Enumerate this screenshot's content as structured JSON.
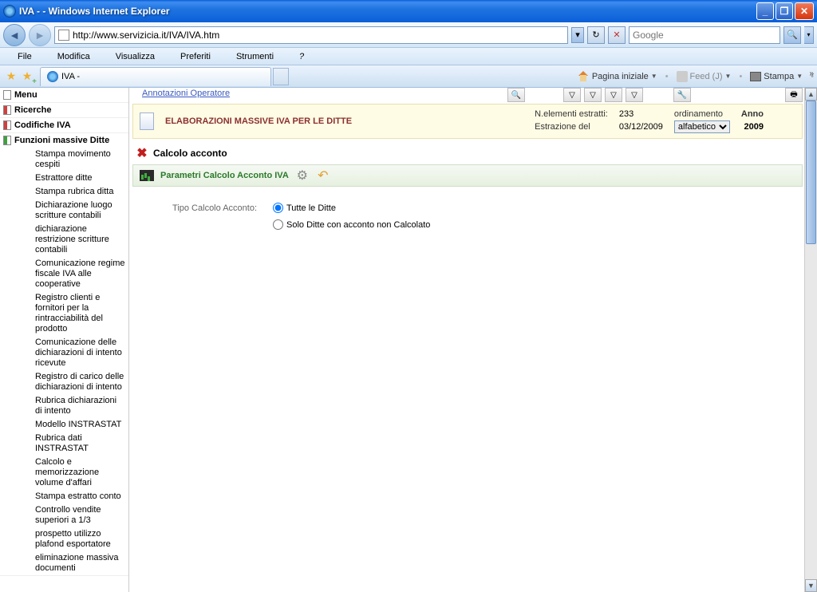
{
  "window": {
    "title": "IVA - - Windows Internet Explorer"
  },
  "address_bar": {
    "url": "http://www.servizicia.it/IVA/IVA.htm"
  },
  "search": {
    "placeholder": "Google"
  },
  "menu": {
    "file": "File",
    "modifica": "Modifica",
    "visualizza": "Visualizza",
    "preferiti": "Preferiti",
    "strumenti": "Strumenti",
    "help": "?"
  },
  "tab": {
    "title": "IVA -"
  },
  "toolbar": {
    "home": "Pagina iniziale",
    "feed": "Feed (J)",
    "stampa": "Stampa"
  },
  "sidebar": {
    "sections": {
      "menu": "Menu",
      "ricerche": "Ricerche",
      "codifiche": "Codifiche IVA",
      "funzioni": "Funzioni massive Ditte"
    },
    "items": [
      "Stampa movimento cespiti",
      "Estrattore ditte",
      "Stampa rubrica ditta",
      "Dichiarazione luogo scritture contabili",
      "dichiarazione restrizione scritture contabili",
      "Comunicazione regime fiscale IVA alle cooperative",
      "Registro clienti e fornitori per la rintracciabilità del prodotto",
      "Comunicazione delle dichiarazioni di intento ricevute",
      "Registro di carico delle dichiarazioni di intento",
      "Rubrica dichiarazioni di intento",
      "Modello INSTRASTAT",
      "Rubrica dati INSTRASTAT",
      "Calcolo e memorizzazione volume d'affari",
      "Stampa estratto conto",
      "Controllo vendite superiori a 1/3",
      "prospetto utilizzo plafond esportatore",
      "eliminazione massiva documenti"
    ]
  },
  "main": {
    "top_link": "Annotazioni Operatore",
    "banner": {
      "title": "ELABORAZIONI MASSIVE IVA PER LE DITTE",
      "n_elementi_label": "N.elementi estratti:",
      "n_elementi_value": "233",
      "estrazione_label": "Estrazione del",
      "estrazione_value": "03/12/2009",
      "ordinamento_label": "ordinamento",
      "ordinamento_value": "alfabetico",
      "anno_label": "Anno",
      "anno_value": "2009"
    },
    "section_title": "Calcolo acconto",
    "sub_banner": {
      "title": "Parametri Calcolo Acconto IVA"
    },
    "form": {
      "tipo_label": "Tipo Calcolo Acconto:",
      "opt_tutte": "Tutte le Ditte",
      "opt_solo": "Solo Ditte con acconto non Calcolato"
    }
  }
}
